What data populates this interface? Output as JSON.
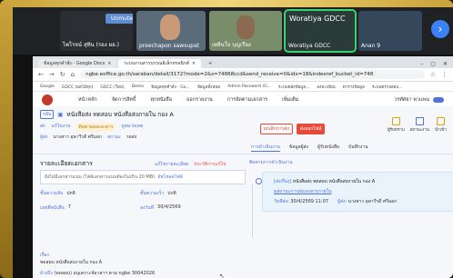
{
  "meeting": {
    "unmute_label": "Unmute",
    "tiles": [
      {
        "name": "ไพโรจน์ สุทิน (รอง ผอ.)"
      },
      {
        "name": "preechapon sawsupat"
      },
      {
        "name": "เพลินใจ บุญเรือง"
      },
      {
        "name": "Woratiya GDCC",
        "caption": "Woratiya GDCC"
      },
      {
        "name": "Anan 9"
      }
    ],
    "next_icon": "chevron-right-icon"
  },
  "browser": {
    "tabs": [
      {
        "label": "ข้อมูลทุกคำสั่ง - Google Docs"
      },
      {
        "label": "ระบบงานสารบรรณอิเล็กทรอนิกส์"
      },
      {
        "label": "+"
      }
    ],
    "url": "ngbe.eoffice.go.th/saraban/detail/3172?mode=2&s=74868ccd&send_receive=0&idx=18&indexref_bucket_id=748",
    "bookmarks": [
      "Google",
      "GDCC (ผลไม้ทุก)",
      "GDCC (ใหม่)",
      "Demo",
      "ข้อมูลทุกคำสั่ง - Go...",
      "ข้อมูลทั้งหมด",
      "Admin Password (G...",
      "ระบบคลังข้อมูล...",
      "ลงทะเบียน",
      "ตารางข้อมูล",
      "ระบบตรวจสอบ..."
    ]
  },
  "app": {
    "menu": [
      "หน้าหลัก",
      "จัดการสิทธิ์",
      "ทุกหนังสือ",
      "ออกรายงาน",
      "การจัดตามเอกสาร",
      "เพิ่มเติม"
    ],
    "user_name": "วรทัศยา พาแพน",
    "title_back": "กลับ",
    "title": "หนังสือส่ง ทดสอบ หนังสือส่งภายใน กอง A",
    "actions": [
      "ส่ง",
      "แก้ไขงาน",
      "ติดตามผลเอกสาร",
      "ดูหมายเหตุ"
    ],
    "field_dept_label": "ผู้ส่ง",
    "field_dept_value": "นางสาว อุษาวีรดี ศรีมอก",
    "field_status_label": "สถานะ",
    "field_status_value": "รอส่ง",
    "right_buttons": [
      "ยกเลิกการส่ง",
      "ส่งออกไฟล์"
    ],
    "right_icons": [
      "ผู้รับทราบ",
      "สถานะงาน",
      "นำเข้า"
    ],
    "subtabs": [
      "การดำเนินงาน",
      "ข้อมูลผู้ส่ง",
      "ผู้รับหนังสือ",
      "บันทึกงาน"
    ],
    "section_title": "รายละเอียดเอกสาร",
    "section_actions": [
      "แก้ไขรายละเอียด",
      "ประวัติการแก้ไข"
    ],
    "attach_text": "ยังไม่มีเอกสารแนบ (ไฟล์เอกสารแนบต้องไม่เกิน 20 MB)",
    "attach_link": "อัพโหลดไฟล์",
    "meta": [
      {
        "label": "ชั้นความลับ",
        "value": "ปกติ",
        "label2": "ชั้นความเร็ว",
        "value2": "ปกติ"
      },
      {
        "label": "เลขที่หนังสือ",
        "value": "7",
        "label2": "ลงวันที่",
        "value2": "30/4/2569"
      }
    ],
    "subject_label": "เรื่อง",
    "subject_value": "ทดสอบ หนังสือส่งภายใน กอง A",
    "ref_label": "อ้างถึง",
    "ref_value": "(ทดสอบ) อนุเคราะห์อาสาฯ ตาม ngbe 30042026",
    "timeline_link": "ติดตามการดำเนินงาน",
    "card": {
      "tag": "[ส่งเรื่อง]",
      "text": "หนังสือส่ง ทดสอบ หนังสือส่งภายใน กอง A",
      "link": "ดูสถานะการส่งเอกสารภายใน",
      "date_label": "วันที่ส่ง",
      "date_value": "30/4/2569 11:07",
      "sender_label": "ผู้ส่ง",
      "sender_value": "นางสาว อุษาวีรดี ศรีมอก"
    }
  }
}
